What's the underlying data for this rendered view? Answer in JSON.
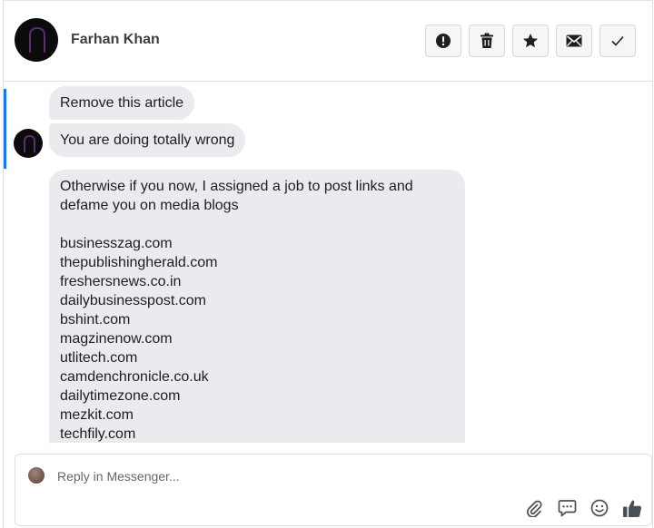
{
  "header": {
    "contact_name": "Farhan Khan",
    "actions": [
      {
        "name": "report-button",
        "icon": "alert-circle-icon"
      },
      {
        "name": "delete-button",
        "icon": "trash-icon"
      },
      {
        "name": "star-button",
        "icon": "star-icon"
      },
      {
        "name": "mark-unread-button",
        "icon": "envelope-icon"
      },
      {
        "name": "mark-done-button",
        "icon": "checkmark-icon"
      }
    ]
  },
  "thread": {
    "messages": [
      {
        "text": "Remove this article"
      },
      {
        "text": "You are doing totally wrong"
      },
      {
        "lines": [
          "Otherwise if you now, I assigned a job to post links and",
          "defame you on media blogs",
          "",
          "businesszag.com",
          "thepublishingherald.com",
          "freshersnews.co.in",
          "dailybusinesspost.com",
          "bshint.com",
          "magzinenow.com",
          "utlitech.com",
          "camdenchronicle.co.uk",
          "dailytimezone.com",
          "mezkit.com",
          "techfily.com"
        ]
      }
    ]
  },
  "composer": {
    "placeholder": "Reply in Messenger...",
    "tools": [
      "paperclip-icon",
      "quick-reply-icon",
      "emoji-icon",
      "thumbs-up-icon"
    ]
  },
  "colors": {
    "accent": "#1877f2",
    "bubble": "#e9ebee",
    "icon": "#1c1e21"
  }
}
